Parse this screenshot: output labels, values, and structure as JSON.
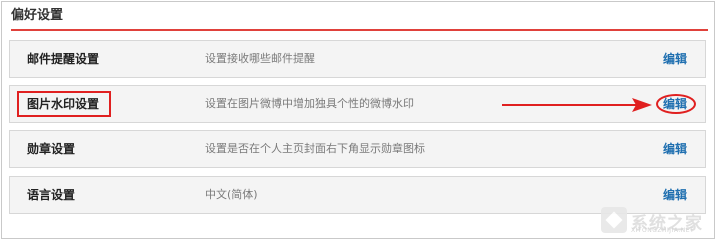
{
  "panel": {
    "title": "偏好设置"
  },
  "rows": [
    {
      "name": "邮件提醒设置",
      "description": "设置接收哪些邮件提醒",
      "action": "编辑"
    },
    {
      "name": "图片水印设置",
      "description": "设置在图片微博中增加独具个性的微博水印",
      "action": "编辑"
    },
    {
      "name": "勋章设置",
      "description": "设置是否在个人主页封面右下角显示勋章图标",
      "action": "编辑"
    },
    {
      "name": "语言设置",
      "description": "中文(简体)",
      "action": "编辑"
    }
  ],
  "annotations": {
    "color": "#e02020",
    "highlighted_row": "图片水印设置"
  },
  "watermark": {
    "text": "系统之家",
    "sub": "XITONGZHIJIA.NET"
  },
  "colors": {
    "accent_rule": "#e0413b",
    "link": "#1f6fb0",
    "row_bg": "#f4f4f4"
  }
}
